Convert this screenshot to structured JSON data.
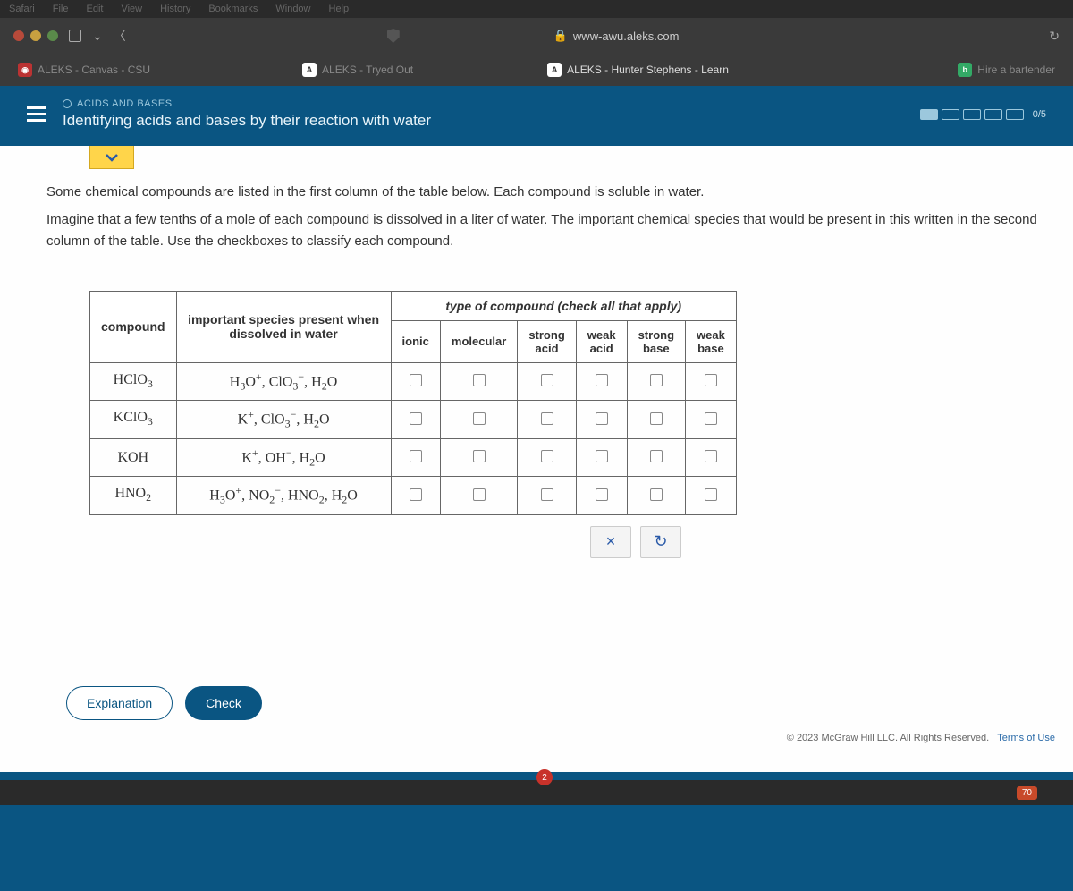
{
  "menubar": [
    "Safari",
    "File",
    "Edit",
    "View",
    "History",
    "Bookmarks",
    "Window",
    "Help"
  ],
  "url": "www-awu.aleks.com",
  "tabs": [
    {
      "icon": "red",
      "label": "ALEKS - Canvas - CSU"
    },
    {
      "icon": "a",
      "label": "ALEKS - Tryed Out"
    },
    {
      "icon": "a",
      "label": "ALEKS - Hunter Stephens - Learn",
      "active": true
    },
    {
      "icon": "b",
      "label": "Hire a bartender"
    }
  ],
  "topic_category": "ACIDS AND BASES",
  "topic_title": "Identifying acids and bases by their reaction with water",
  "progress_label": "0/5",
  "instruction_p1": "Some chemical compounds are listed in the first column of the table below. Each compound is soluble in water.",
  "instruction_p2": "Imagine that a few tenths of a mole of each compound is dissolved in a liter of water. The important chemical species that would be present in this written in the second column of the table. Use the checkboxes to classify each compound.",
  "table_headers": {
    "compound": "compound",
    "species": "important species present when dissolved in water",
    "type": "type of compound (check all that apply)",
    "cols": [
      "ionic",
      "molecular",
      "strong acid",
      "weak acid",
      "strong base",
      "weak base"
    ]
  },
  "rows": [
    {
      "compound": "HClO3",
      "compound_fmt": "HClO<sub>3</sub>",
      "species": "H<sub>3</sub>O<sup>+</sup>, ClO<sub>3</sub><sup>−</sup>, H<sub>2</sub>O"
    },
    {
      "compound": "KClO3",
      "compound_fmt": "KClO<sub>3</sub>",
      "species": "K<sup>+</sup>, ClO<sub>3</sub><sup>−</sup>, H<sub>2</sub>O"
    },
    {
      "compound": "KOH",
      "compound_fmt": "KOH",
      "species": "K<sup>+</sup>, OH<sup>−</sup>, H<sub>2</sub>O"
    },
    {
      "compound": "HNO2",
      "compound_fmt": "HNO<sub>2</sub>",
      "species": "H<sub>3</sub>O<sup>+</sup>, NO<sub>2</sub><sup>−</sup>, HNO<sub>2</sub>, H<sub>2</sub>O"
    }
  ],
  "clear_icon": "×",
  "reset_icon": "↻",
  "footer": {
    "explanation": "Explanation",
    "check": "Check"
  },
  "copyright": "© 2023 McGraw Hill LLC. All Rights Reserved.",
  "terms": "Terms of Use",
  "badge": "70",
  "notif": "2"
}
